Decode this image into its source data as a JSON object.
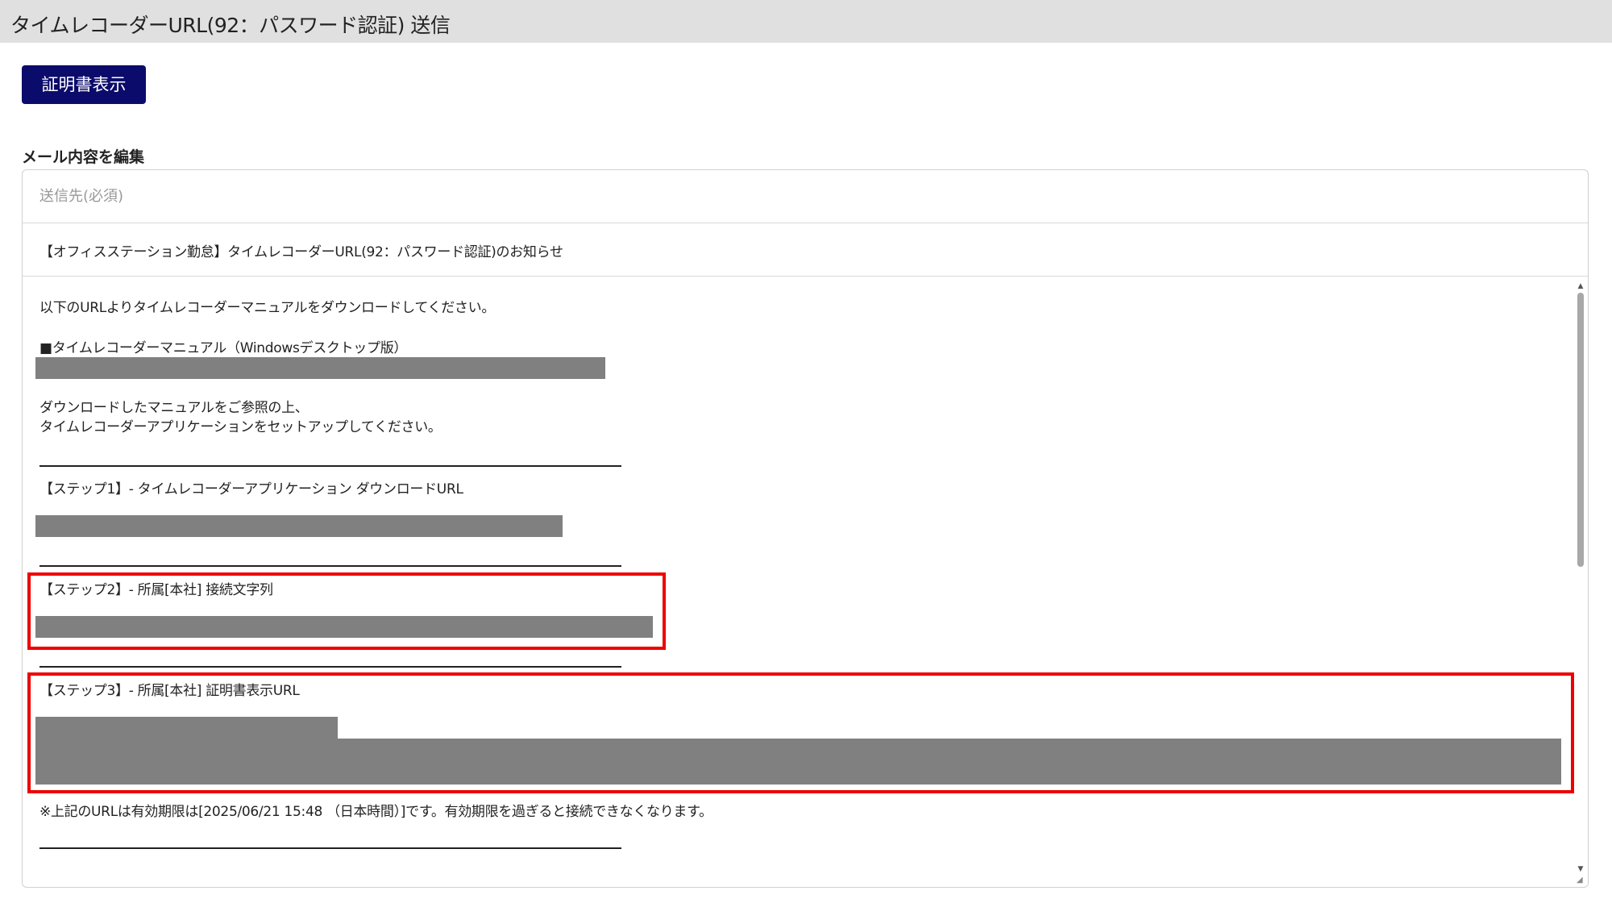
{
  "window": {
    "title": "タイムレコーダーURL(92：パスワード認証) 送信"
  },
  "toolbar": {
    "cert_button_label": "証明書表示"
  },
  "editor": {
    "heading": "メール内容を編集",
    "to_placeholder": "送信先(必須)",
    "to_value": "",
    "subject": "【オフィスステーション勤怠】タイムレコーダーURL(92：パスワード認証)のお知らせ",
    "body": {
      "intro": "以下のURLよりタイムレコーダーマニュアルをダウンロードしてください。",
      "manual_heading": "■タイムレコーダーマニュアル（Windowsデスクトップ版）",
      "instruction_1": "ダウンロードしたマニュアルをご参照の上、",
      "instruction_2": "タイムレコーダーアプリケーションをセットアップしてください。",
      "step1": "【ステップ1】- タイムレコーダーアプリケーション ダウンロードURL",
      "step2": "【ステップ2】- 所属[本社] 接続文字列",
      "step3": "【ステップ3】- 所属[本社] 証明書表示URL",
      "expiry_note": "※上記のURLは有効期限は[2025/06/21 15:48 （日本時間）]です。有効期限を過ぎると接続できなくなります。"
    }
  },
  "colors": {
    "title_bar_bg": "#e0e0e0",
    "button_bg": "#0b0b6b",
    "redaction": "#808080",
    "highlight_border": "#ee0000"
  }
}
